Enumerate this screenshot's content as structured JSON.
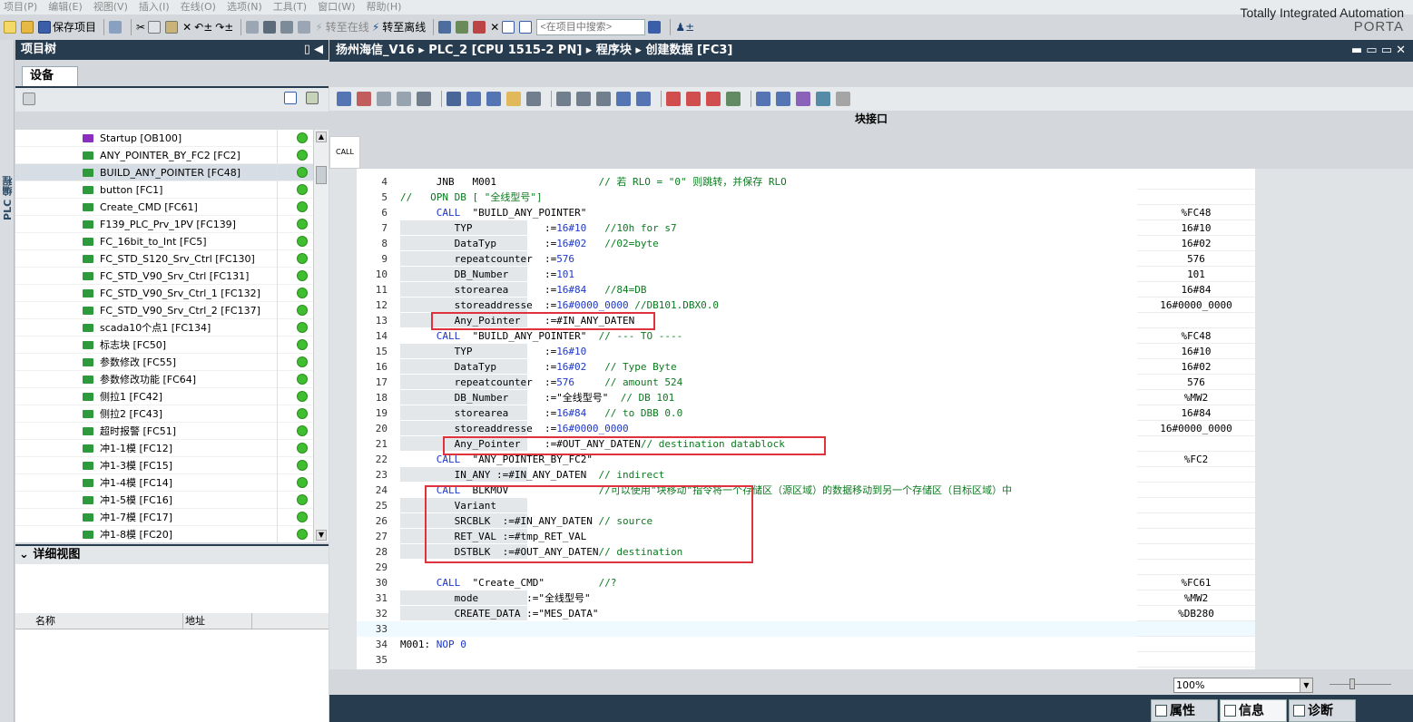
{
  "menu": [
    "项目(P)",
    "编辑(E)",
    "视图(V)",
    "插入(I)",
    "在线(O)",
    "选项(N)",
    "工具(T)",
    "窗口(W)",
    "帮助(H)"
  ],
  "brand": {
    "line1": "Totally Integrated Automation",
    "line2": "PORTA"
  },
  "toolbar": {
    "save_label": "保存项目",
    "go_online": "转至在线",
    "go_offline": "转至离线",
    "search_placeholder": "<在项目中搜索>"
  },
  "left_strip_label": "PLC 编程",
  "project_tree": {
    "title": "项目树",
    "devices_tab": "设备",
    "items": [
      {
        "label": "Startup [OB100]",
        "kind": "ob"
      },
      {
        "label": "ANY_POINTER_BY_FC2 [FC2]",
        "kind": "fc"
      },
      {
        "label": "BUILD_ANY_POINTER [FC48]",
        "kind": "fc",
        "selected": true
      },
      {
        "label": "button [FC1]",
        "kind": "fc"
      },
      {
        "label": "Create_CMD [FC61]",
        "kind": "fc"
      },
      {
        "label": "F139_PLC_Prv_1PV [FC139]",
        "kind": "fc"
      },
      {
        "label": "FC_16bit_to_Int [FC5]",
        "kind": "fc"
      },
      {
        "label": "FC_STD_S120_Srv_Ctrl [FC130]",
        "kind": "fc"
      },
      {
        "label": "FC_STD_V90_Srv_Ctrl [FC131]",
        "kind": "fc"
      },
      {
        "label": "FC_STD_V90_Srv_Ctrl_1 [FC132]",
        "kind": "fc"
      },
      {
        "label": "FC_STD_V90_Srv_Ctrl_2 [FC137]",
        "kind": "fc"
      },
      {
        "label": "scada10个点1 [FC134]",
        "kind": "fc"
      },
      {
        "label": "标志块 [FC50]",
        "kind": "fc"
      },
      {
        "label": "参数修改 [FC55]",
        "kind": "fc"
      },
      {
        "label": "参数修改功能 [FC64]",
        "kind": "fc"
      },
      {
        "label": "侧拉1 [FC42]",
        "kind": "fc"
      },
      {
        "label": "侧拉2 [FC43]",
        "kind": "fc"
      },
      {
        "label": "超时报警 [FC51]",
        "kind": "fc"
      },
      {
        "label": "冲1-1模 [FC12]",
        "kind": "fc"
      },
      {
        "label": "冲1-3模 [FC15]",
        "kind": "fc"
      },
      {
        "label": "冲1-4模 [FC14]",
        "kind": "fc"
      },
      {
        "label": "冲1-5模 [FC16]",
        "kind": "fc"
      },
      {
        "label": "冲1-7模 [FC17]",
        "kind": "fc"
      },
      {
        "label": "冲1-8模 [FC20]",
        "kind": "fc"
      }
    ]
  },
  "detail_view": {
    "title": "详细视图",
    "col_name": "名称",
    "col_address": "地址"
  },
  "breadcrumb": {
    "project": "扬州海信_V16",
    "plc": "PLC_2 [CPU 1515-2 PN]",
    "folder": "程序块",
    "block": "创建数据 [FC3]"
  },
  "block_interface": "块接口",
  "call_tab": "CALL",
  "code_lines": [
    {
      "n": "4",
      "segs": [
        {
          "t": "      JNB   M001                 ",
          "c": ""
        },
        {
          "t": "// 若 RLO = \"0\" 则跳转，并保存 RLO",
          "c": "cm"
        }
      ],
      "op": ""
    },
    {
      "n": "5",
      "segs": [
        {
          "t": "//   OPN DB [ \"全线型号\"]",
          "c": "cm"
        }
      ],
      "op": ""
    },
    {
      "n": "6",
      "segs": [
        {
          "t": "      ",
          "c": ""
        },
        {
          "t": "CALL",
          "c": "kw"
        },
        {
          "t": "  \"BUILD_ANY_POINTER\"",
          "c": ""
        }
      ],
      "op": "%FC48"
    },
    {
      "n": "7",
      "segs": [
        {
          "t": "         TYP            :=",
          "c": ""
        },
        {
          "t": "16#10",
          "c": "num"
        },
        {
          "t": "   ",
          "c": ""
        },
        {
          "t": "//10h for s7",
          "c": "cm"
        }
      ],
      "op": "16#10"
    },
    {
      "n": "8",
      "segs": [
        {
          "t": "         DataTyp        :=",
          "c": ""
        },
        {
          "t": "16#02",
          "c": "num"
        },
        {
          "t": "   ",
          "c": ""
        },
        {
          "t": "//02=byte",
          "c": "cm"
        }
      ],
      "op": "16#02"
    },
    {
      "n": "9",
      "segs": [
        {
          "t": "         repeatcounter  :=",
          "c": ""
        },
        {
          "t": "576",
          "c": "num"
        }
      ],
      "op": "576"
    },
    {
      "n": "10",
      "segs": [
        {
          "t": "         DB_Number      :=",
          "c": ""
        },
        {
          "t": "101",
          "c": "num"
        }
      ],
      "op": "101"
    },
    {
      "n": "11",
      "segs": [
        {
          "t": "         storearea      :=",
          "c": ""
        },
        {
          "t": "16#84",
          "c": "num"
        },
        {
          "t": "   ",
          "c": ""
        },
        {
          "t": "//84=DB",
          "c": "cm"
        }
      ],
      "op": "16#84"
    },
    {
      "n": "12",
      "segs": [
        {
          "t": "         storeaddresse  :=",
          "c": ""
        },
        {
          "t": "16#0000_0000",
          "c": "num"
        },
        {
          "t": " ",
          "c": ""
        },
        {
          "t": "//DB101.DBX0.0",
          "c": "cm"
        }
      ],
      "op": "16#0000_0000"
    },
    {
      "n": "13",
      "segs": [
        {
          "t": "         Any_Pointer    :=#IN_ANY_DATEN",
          "c": ""
        }
      ],
      "op": ""
    },
    {
      "n": "14",
      "segs": [
        {
          "t": "      ",
          "c": ""
        },
        {
          "t": "CALL",
          "c": "kw"
        },
        {
          "t": "  \"BUILD_ANY_POINTER\"  ",
          "c": ""
        },
        {
          "t": "// --- TO ----",
          "c": "cm"
        }
      ],
      "op": "%FC48"
    },
    {
      "n": "15",
      "segs": [
        {
          "t": "         TYP            :=",
          "c": ""
        },
        {
          "t": "16#10",
          "c": "num"
        }
      ],
      "op": "16#10"
    },
    {
      "n": "16",
      "segs": [
        {
          "t": "         DataTyp        :=",
          "c": ""
        },
        {
          "t": "16#02",
          "c": "num"
        },
        {
          "t": "   ",
          "c": ""
        },
        {
          "t": "// Type Byte",
          "c": "cm"
        }
      ],
      "op": "16#02"
    },
    {
      "n": "17",
      "segs": [
        {
          "t": "         repeatcounter  :=",
          "c": ""
        },
        {
          "t": "576",
          "c": "num"
        },
        {
          "t": "     ",
          "c": ""
        },
        {
          "t": "// amount 524",
          "c": "cm"
        }
      ],
      "op": "576"
    },
    {
      "n": "18",
      "segs": [
        {
          "t": "         DB_Number      :=\"全线型号\"  ",
          "c": ""
        },
        {
          "t": "// DB 101",
          "c": "cm"
        }
      ],
      "op": "%MW2"
    },
    {
      "n": "19",
      "segs": [
        {
          "t": "         storearea      :=",
          "c": ""
        },
        {
          "t": "16#84",
          "c": "num"
        },
        {
          "t": "   ",
          "c": ""
        },
        {
          "t": "// to DBB 0.0",
          "c": "cm"
        }
      ],
      "op": "16#84"
    },
    {
      "n": "20",
      "segs": [
        {
          "t": "         storeaddresse  :=",
          "c": ""
        },
        {
          "t": "16#0000_0000",
          "c": "num"
        }
      ],
      "op": "16#0000_0000"
    },
    {
      "n": "21",
      "segs": [
        {
          "t": "         Any_Pointer    :=#OUT_ANY_DATEN",
          "c": ""
        },
        {
          "t": "// destination datablock",
          "c": "cm"
        }
      ],
      "op": ""
    },
    {
      "n": "22",
      "segs": [
        {
          "t": "      ",
          "c": ""
        },
        {
          "t": "CALL",
          "c": "kw"
        },
        {
          "t": "  \"ANY_POINTER_BY_FC2\"",
          "c": ""
        }
      ],
      "op": "%FC2"
    },
    {
      "n": "23",
      "segs": [
        {
          "t": "         IN_ANY :=#IN_ANY_DATEN  ",
          "c": ""
        },
        {
          "t": "// indirect",
          "c": "cm"
        }
      ],
      "op": ""
    },
    {
      "n": "24",
      "segs": [
        {
          "t": "      ",
          "c": ""
        },
        {
          "t": "CALL",
          "c": "kw"
        },
        {
          "t": "  BLKMOV               ",
          "c": ""
        },
        {
          "t": "//可以使用\"块移动\"指令将一个存储区（源区域）的数据移动到另一个存储区（目标区域）中",
          "c": "cm"
        }
      ],
      "op": ""
    },
    {
      "n": "25",
      "segs": [
        {
          "t": "         Variant",
          "c": ""
        }
      ],
      "op": ""
    },
    {
      "n": "26",
      "segs": [
        {
          "t": "         SRCBLK  :=#IN_ANY_DATEN ",
          "c": ""
        },
        {
          "t": "// source",
          "c": "cm"
        }
      ],
      "op": ""
    },
    {
      "n": "27",
      "segs": [
        {
          "t": "         RET_VAL :=#tmp_RET_VAL",
          "c": ""
        }
      ],
      "op": ""
    },
    {
      "n": "28",
      "segs": [
        {
          "t": "         DSTBLK  :=#OUT_ANY_DATEN",
          "c": ""
        },
        {
          "t": "// destination",
          "c": "cm"
        }
      ],
      "op": ""
    },
    {
      "n": "29",
      "segs": [],
      "op": ""
    },
    {
      "n": "30",
      "segs": [
        {
          "t": "      ",
          "c": ""
        },
        {
          "t": "CALL",
          "c": "kw"
        },
        {
          "t": "  \"Create_CMD\"         ",
          "c": ""
        },
        {
          "t": "//?",
          "c": "cm"
        }
      ],
      "op": "%FC61"
    },
    {
      "n": "31",
      "segs": [
        {
          "t": "         mode        :=\"全线型号\"",
          "c": ""
        }
      ],
      "op": "%MW2"
    },
    {
      "n": "32",
      "segs": [
        {
          "t": "         CREATE_DATA :=\"MES_DATA\"",
          "c": ""
        }
      ],
      "op": "%DB280"
    },
    {
      "n": "33",
      "segs": [],
      "op": ""
    },
    {
      "n": "34",
      "segs": [
        {
          "t": "M001: ",
          "c": ""
        },
        {
          "t": "NOP 0",
          "c": "kw"
        }
      ],
      "op": ""
    },
    {
      "n": "35",
      "segs": [],
      "op": ""
    }
  ],
  "zoom": "100%",
  "bottom_tabs": {
    "properties": "属性",
    "info": "信息",
    "diagnostics": "诊断"
  }
}
